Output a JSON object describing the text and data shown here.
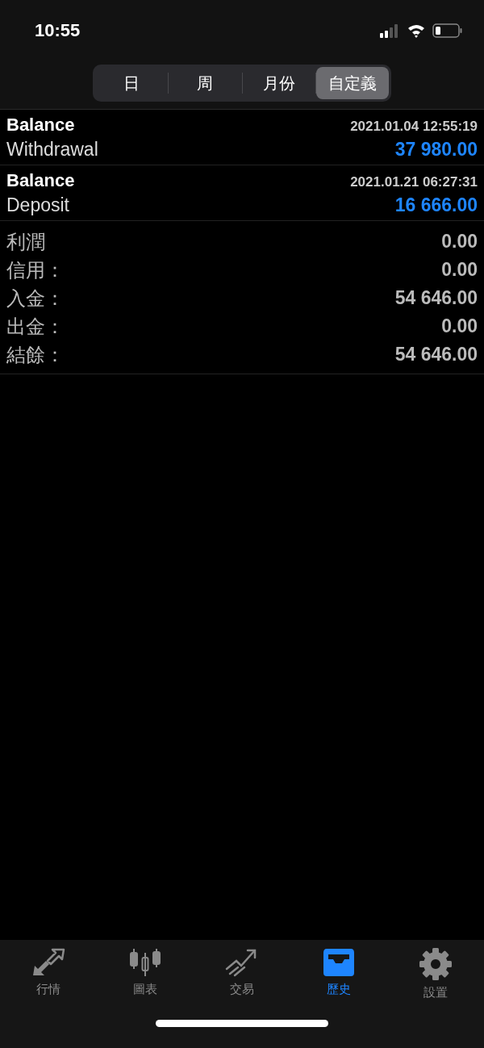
{
  "status_bar": {
    "time": "10:55"
  },
  "segments": [
    {
      "label": "日",
      "selected": false
    },
    {
      "label": "周",
      "selected": false
    },
    {
      "label": "月份",
      "selected": false
    },
    {
      "label": "自定義",
      "selected": true
    }
  ],
  "transactions": [
    {
      "type": "Balance",
      "time": "2021.01.04 12:55:19",
      "comment": "Withdrawal",
      "amount": "37 980.00"
    },
    {
      "type": "Balance",
      "time": "2021.01.21 06:27:31",
      "comment": "Deposit",
      "amount": "16 666.00"
    }
  ],
  "summary": [
    {
      "label": "利潤",
      "value": "0.00"
    },
    {
      "label": "信用：",
      "value": "0.00"
    },
    {
      "label": "入金：",
      "value": "54 646.00"
    },
    {
      "label": "出金：",
      "value": "0.00"
    },
    {
      "label": "結餘：",
      "value": "54 646.00"
    }
  ],
  "tab_bar": [
    {
      "label": "行情",
      "kind": "quotes",
      "selected": false
    },
    {
      "label": "圖表",
      "kind": "chart",
      "selected": false
    },
    {
      "label": "交易",
      "kind": "trade",
      "selected": false
    },
    {
      "label": "歷史",
      "kind": "history",
      "selected": true
    },
    {
      "label": "設置",
      "kind": "settings",
      "selected": false
    }
  ]
}
